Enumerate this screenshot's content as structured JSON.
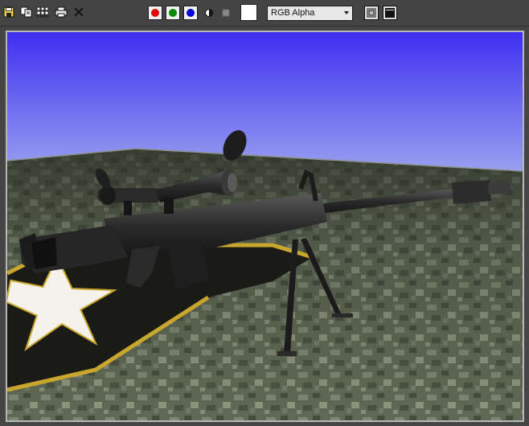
{
  "toolbar": {
    "buttons": [
      {
        "name": "save-icon"
      },
      {
        "name": "copy-icon"
      },
      {
        "name": "clone-icon"
      },
      {
        "name": "print-icon"
      },
      {
        "name": "close-icon"
      }
    ],
    "channels": [
      {
        "name": "red-channel-toggle",
        "color": "#e00000"
      },
      {
        "name": "green-channel-toggle",
        "color": "#008a00"
      },
      {
        "name": "blue-channel-toggle",
        "color": "#0000d8"
      }
    ],
    "channel_display": "RGB Alpha",
    "swatch_color": "#ffffff"
  },
  "viewport": {
    "sky_top": "#3f2ff2",
    "sky_bottom": "#a6b2ee",
    "ground_color": "#5b6650"
  }
}
